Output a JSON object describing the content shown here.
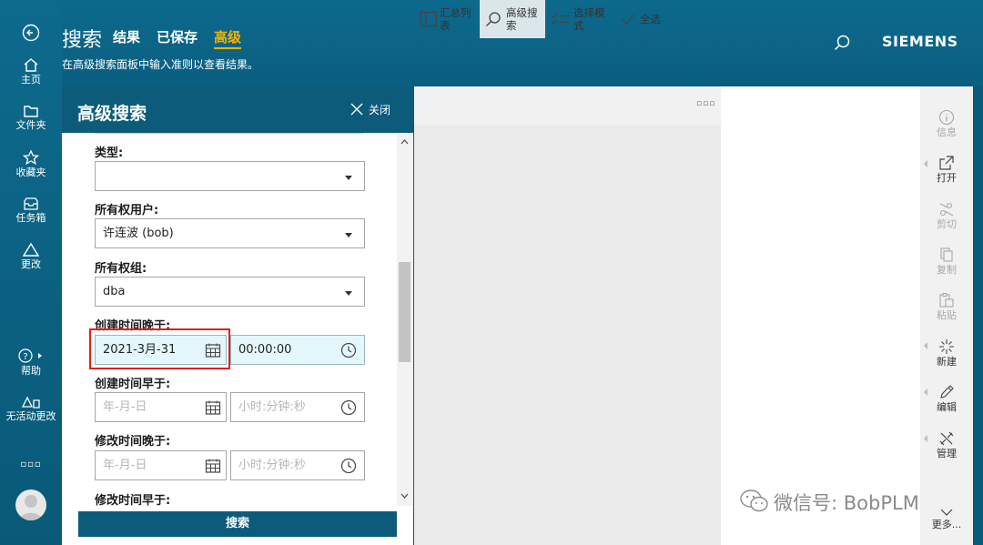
{
  "header": {
    "title": "搜索",
    "tabs": [
      {
        "label": "结果",
        "active": false
      },
      {
        "label": "已保存",
        "active": false
      },
      {
        "label": "高级",
        "active": true
      }
    ],
    "subtitle": "在高级搜索面板中输入准则以查看结果。",
    "brand": "SIEMENS",
    "search_icon": "search-icon",
    "accent_color": "#f7b300",
    "header_color": "#0d6a8d"
  },
  "rail": {
    "items": [
      {
        "label": "主页",
        "icon": "home-icon"
      },
      {
        "label": "文件夹",
        "icon": "folder-icon"
      },
      {
        "label": "收藏夹",
        "icon": "star-icon"
      },
      {
        "label": "任务箱",
        "icon": "inbox-icon"
      },
      {
        "label": "更改",
        "icon": "change-icon"
      },
      {
        "label": "帮助",
        "icon": "help-icon"
      },
      {
        "label": "无活动更改",
        "icon": "no-change-icon"
      }
    ],
    "more_label": "▫▫▫"
  },
  "panel": {
    "title": "高级搜索",
    "close_label": "关闭",
    "fields": {
      "type_label": "类型:",
      "type_value": "",
      "owner_label": "所有权用户:",
      "owner_value": "许连波 (bob)",
      "group_label": "所有权组:",
      "group_value": "dba",
      "created_after_label": "创建时间晚于:",
      "created_after_date": "2021-3月-31",
      "created_after_time": "00:00:00",
      "created_before_label": "创建时间早于:",
      "created_before_date_ph": "年-月-日",
      "created_before_time_ph": "小时:分钟:秒",
      "modified_after_label": "修改时间晚于:",
      "modified_after_date_ph": "年-月-日",
      "modified_after_time_ph": "小时:分钟:秒",
      "modified_before_label": "修改时间早于:"
    },
    "search_button": "搜索",
    "highlight_color": "#e0201c"
  },
  "toolbar": {
    "items": [
      {
        "label_line1": "汇总列",
        "label_line2": "表",
        "icon": "summary-table-icon"
      },
      {
        "label_line1": "高级搜",
        "label_line2": "索",
        "icon": "search-icon"
      },
      {
        "label_line1": "选择模",
        "label_line2": "式",
        "icon": "selection-mode-icon"
      },
      {
        "label_line1": "全选",
        "label_line2": "",
        "icon": "check-icon"
      }
    ],
    "overflow": "▫▫▫"
  },
  "right_rail": {
    "items": [
      {
        "label": "信息",
        "icon": "info-icon",
        "enabled": false
      },
      {
        "label": "打开",
        "icon": "open-icon",
        "enabled": true
      },
      {
        "label": "剪切",
        "icon": "cut-icon",
        "enabled": false
      },
      {
        "label": "复制",
        "icon": "copy-icon",
        "enabled": false
      },
      {
        "label": "粘贴",
        "icon": "paste-icon",
        "enabled": false
      },
      {
        "label": "新建",
        "icon": "new-icon",
        "enabled": true
      },
      {
        "label": "编辑",
        "icon": "edit-icon",
        "enabled": true
      },
      {
        "label": "管理",
        "icon": "manage-icon",
        "enabled": true
      },
      {
        "label": "更多...",
        "icon": "chevron-down-icon",
        "enabled": true
      }
    ]
  },
  "watermark": "微信号: BobPLM"
}
